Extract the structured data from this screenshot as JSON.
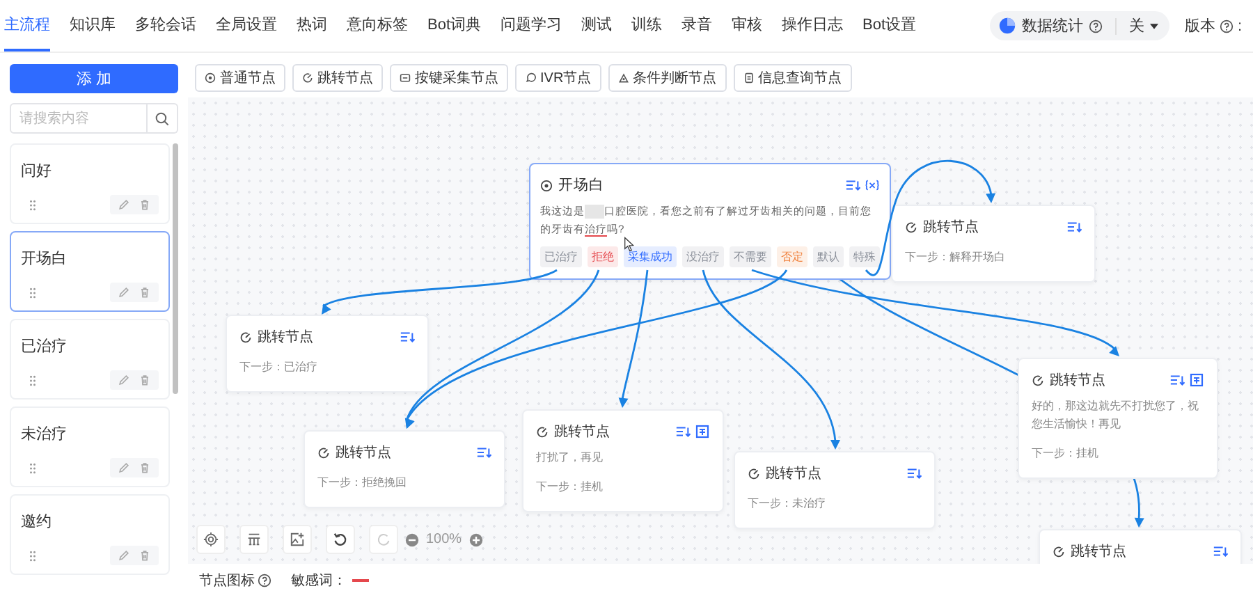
{
  "nav": {
    "tabs": [
      {
        "label": "主流程",
        "selected": true
      },
      {
        "label": "知识库",
        "selected": false
      },
      {
        "label": "多轮会话",
        "selected": false
      },
      {
        "label": "全局设置",
        "selected": false
      },
      {
        "label": "热词",
        "selected": false
      },
      {
        "label": "意向标签",
        "selected": false
      },
      {
        "label": "Bot词典",
        "selected": false
      },
      {
        "label": "问题学习",
        "selected": false
      },
      {
        "label": "测试",
        "selected": false
      },
      {
        "label": "训练",
        "selected": false
      },
      {
        "label": "录音",
        "selected": false
      },
      {
        "label": "审核",
        "selected": false
      },
      {
        "label": "操作日志",
        "selected": false
      },
      {
        "label": "Bot设置",
        "selected": false
      }
    ],
    "stats": {
      "label": "数据统计",
      "value": "关"
    },
    "version_label": "版本",
    "version_colon": ":"
  },
  "sidebar": {
    "add_button": "添 加",
    "search": {
      "placeholder": "请搜索内容"
    },
    "items": [
      {
        "label": "问好",
        "selected": false
      },
      {
        "label": "开场白",
        "selected": true
      },
      {
        "label": "已治疗",
        "selected": false
      },
      {
        "label": "未治疗",
        "selected": false
      },
      {
        "label": "邀约",
        "selected": false
      }
    ]
  },
  "toolbar": [
    {
      "label": "普通节点",
      "kind": "normal"
    },
    {
      "label": "跳转节点",
      "kind": "jump"
    },
    {
      "label": "按键采集节点",
      "kind": "keypad"
    },
    {
      "label": "IVR节点",
      "kind": "ivr"
    },
    {
      "label": "条件判断节点",
      "kind": "condition"
    },
    {
      "label": "信息查询节点",
      "kind": "query"
    }
  ],
  "flow": {
    "start_node": {
      "title": "开场白",
      "prompt": [
        {
          "kind": "plain",
          "text": "我这边是"
        },
        {
          "kind": "redacted"
        },
        {
          "kind": "plain",
          "text": "口腔医院，看您之前有了解过牙齿相关的问题，目前您的牙齿有"
        },
        {
          "kind": "sensitive",
          "text": "治疗"
        },
        {
          "kind": "plain",
          "text": "吗?"
        }
      ],
      "branches": [
        {
          "label": "已治疗",
          "color": "#8a8f99"
        },
        {
          "label": "拒绝",
          "color": "#e5484d"
        },
        {
          "label": "采集成功",
          "color": "#2f6bff"
        },
        {
          "label": "没治疗",
          "color": "#8a8f99"
        },
        {
          "label": "不需要",
          "color": "#8a8f99"
        },
        {
          "label": "否定",
          "color": "#f0803c"
        },
        {
          "label": "默认",
          "color": "#8a8f99"
        },
        {
          "label": "特殊",
          "color": "#8a8f99"
        }
      ]
    },
    "nodes": [
      {
        "title": "跳转节点",
        "next": "下一步：解释开场白"
      },
      {
        "title": "跳转节点",
        "next": "下一步：已治疗"
      },
      {
        "title": "跳转节点",
        "next": "下一步：拒绝挽回"
      },
      {
        "title": "跳转节点",
        "message": "打扰了，再见",
        "next": "下一步：挂机"
      },
      {
        "title": "跳转节点",
        "next": "下一步：未治疗"
      },
      {
        "title": "跳转节点",
        "message": "好的，那这边就先不打扰您了，祝您生活愉快！再见",
        "next": "下一步：挂机"
      },
      {
        "title": "跳转节点"
      }
    ]
  },
  "zoom": "100%",
  "footer": {
    "node_icon_label": "节点图标",
    "sensitive_label": "敏感词："
  }
}
